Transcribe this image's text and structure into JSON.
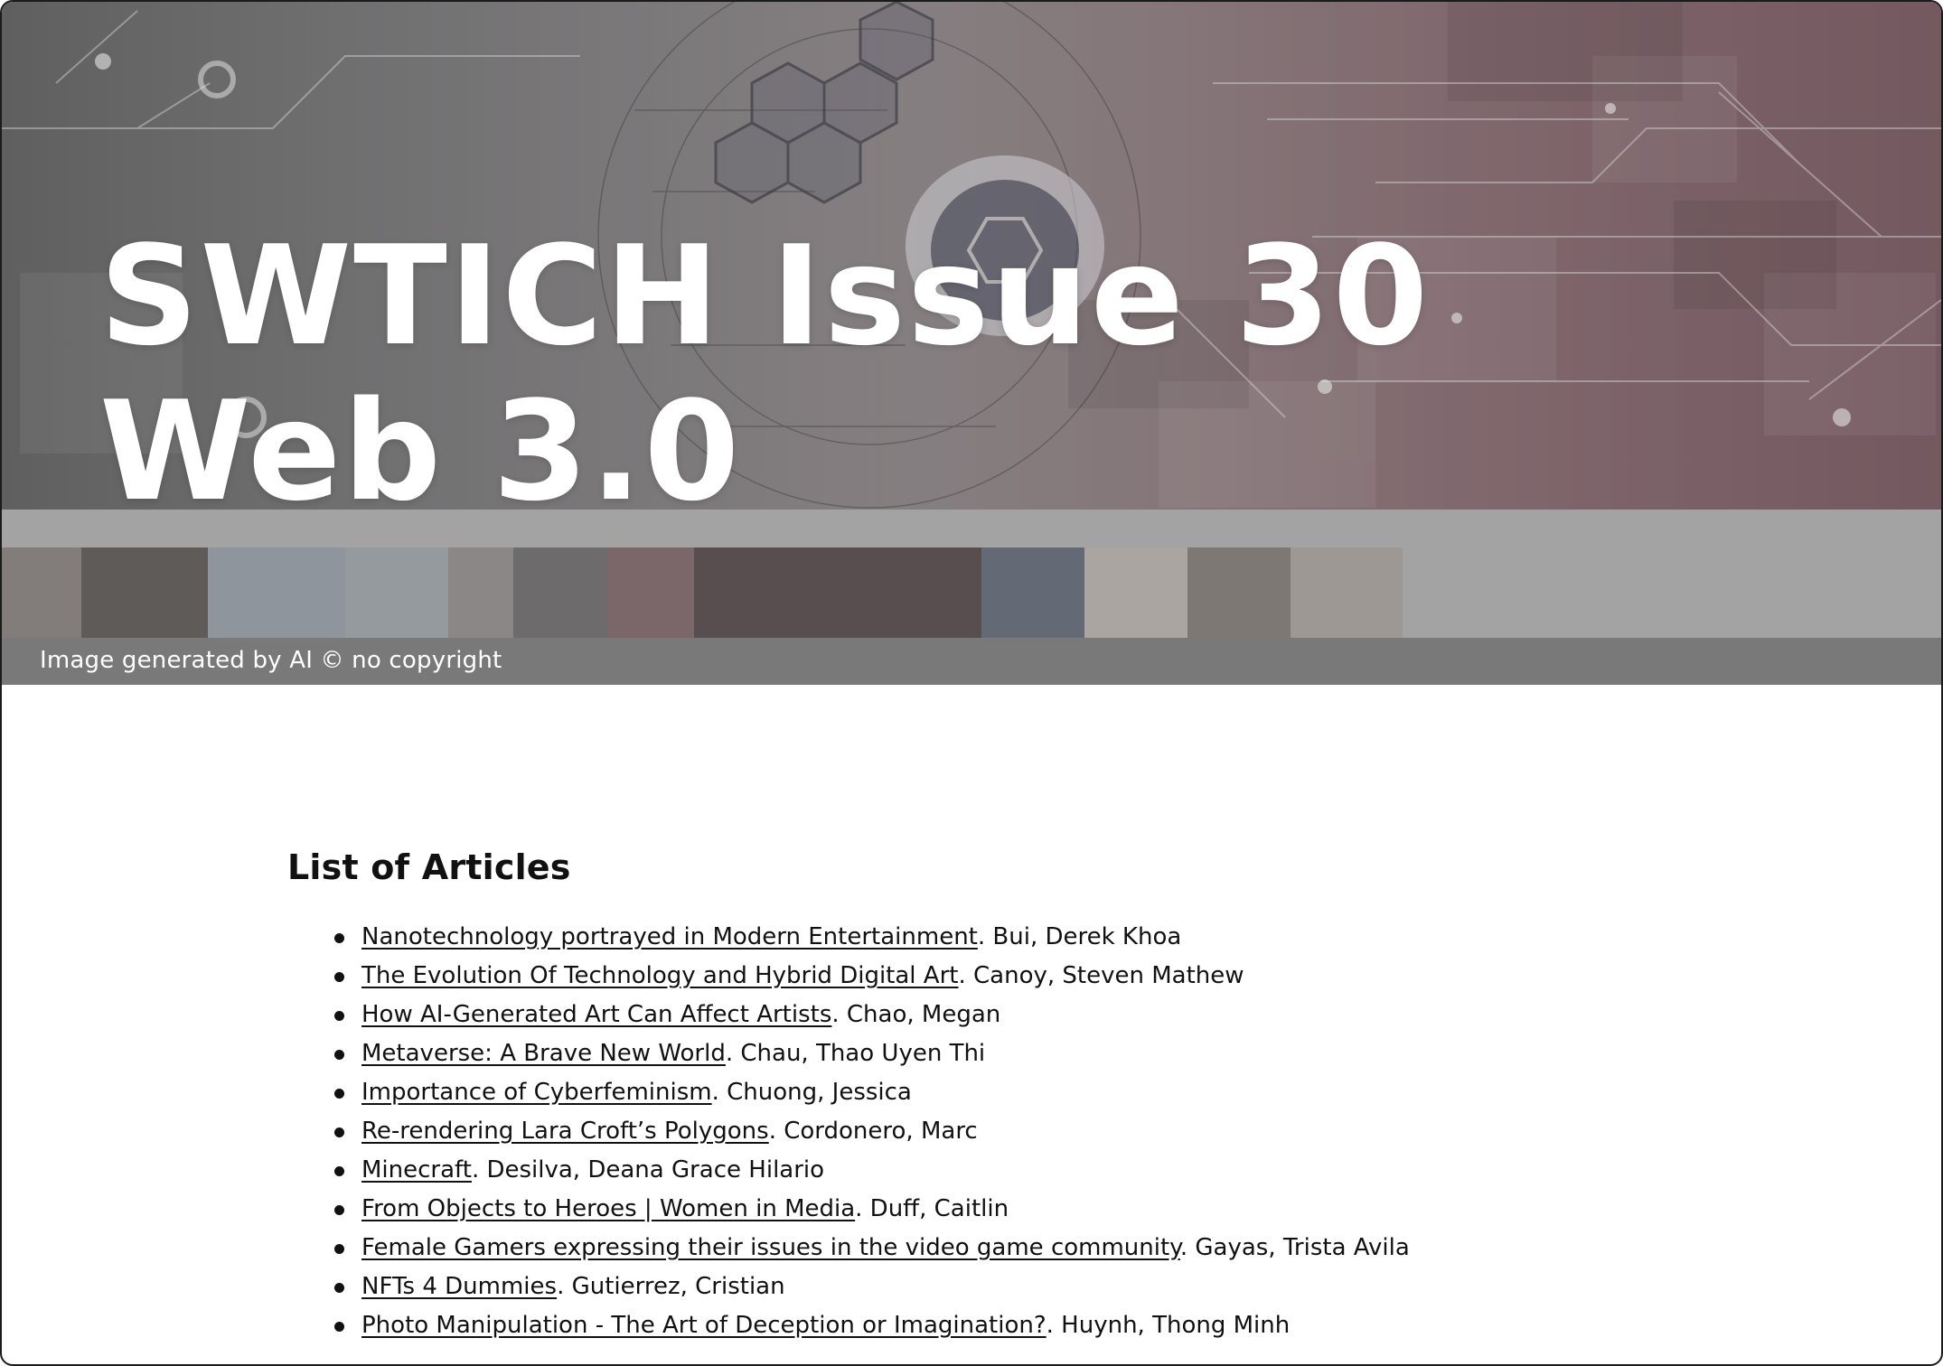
{
  "hero": {
    "title_line1": "SWTICH Issue 30",
    "title_line2": "Web 3.0",
    "image_caption": "Image generated by AI © no copyright"
  },
  "articles_section": {
    "heading": "List of Articles",
    "items": [
      {
        "title": "Nanotechnology portrayed in Modern Entertainment",
        "author": ". Bui, Derek Khoa"
      },
      {
        "title": "The Evolution Of Technology and Hybrid Digital Art",
        "author": ". Canoy, Steven Mathew"
      },
      {
        "title": "How AI-Generated Art Can Affect Artists",
        "author": ". Chao, Megan"
      },
      {
        "title": "Metaverse: A Brave New World",
        "author": ". Chau, Thao Uyen Thi"
      },
      {
        "title": "Importance of Cyberfeminism",
        "author": ". Chuong, Jessica"
      },
      {
        "title": "Re-rendering Lara Croft’s Polygons",
        "author": ". Cordonero, Marc"
      },
      {
        "title": "Minecraft",
        "author": ". Desilva, Deana Grace Hilario"
      },
      {
        "title": "From Objects to Heroes | Women in Media",
        "author": ". Duff, Caitlin"
      },
      {
        "title": "Female Gamers expressing their issues in the video game community",
        "author": ". Gayas, Trista Avila"
      },
      {
        "title": "NFTs 4 Dummies",
        "author": ". Gutierrez, Cristian"
      },
      {
        "title": "Photo Manipulation - The Art of Deception or Imagination?",
        "author": ". Huynh, Thong Minh"
      }
    ]
  }
}
